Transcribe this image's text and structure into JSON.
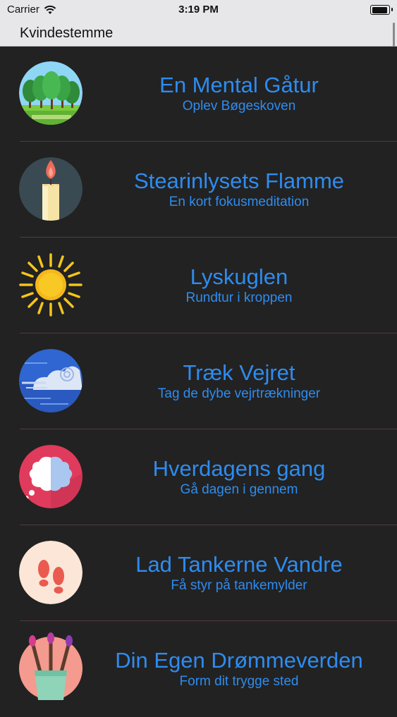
{
  "status_bar": {
    "carrier": "Carrier",
    "time": "3:19 PM"
  },
  "nav": {
    "title": "Kvindestemme"
  },
  "items": [
    {
      "title": "En Mental Gåtur",
      "subtitle": "Oplev Bøgeskoven",
      "icon": "forest-icon"
    },
    {
      "title": "Stearinlysets Flamme",
      "subtitle": "En kort fokusmeditation",
      "icon": "candle-icon"
    },
    {
      "title": "Lyskuglen",
      "subtitle": "Rundtur i kroppen",
      "icon": "sun-icon"
    },
    {
      "title": "Træk Vejret",
      "subtitle": "Tag de dybe vejrtrækninger",
      "icon": "wind-icon"
    },
    {
      "title": "Hverdagens gang",
      "subtitle": "Gå dagen i gennem",
      "icon": "cloud-thought-icon"
    },
    {
      "title": "Lad Tankerne Vandre",
      "subtitle": "Få styr på tankemylder",
      "icon": "footprints-icon"
    },
    {
      "title": "Din Egen Drømmeverden",
      "subtitle": "Form dit trygge sted",
      "icon": "paintbrushes-icon"
    }
  ],
  "colors": {
    "accent": "#2e8cf0",
    "background": "#222222",
    "separator": "#54393f"
  }
}
